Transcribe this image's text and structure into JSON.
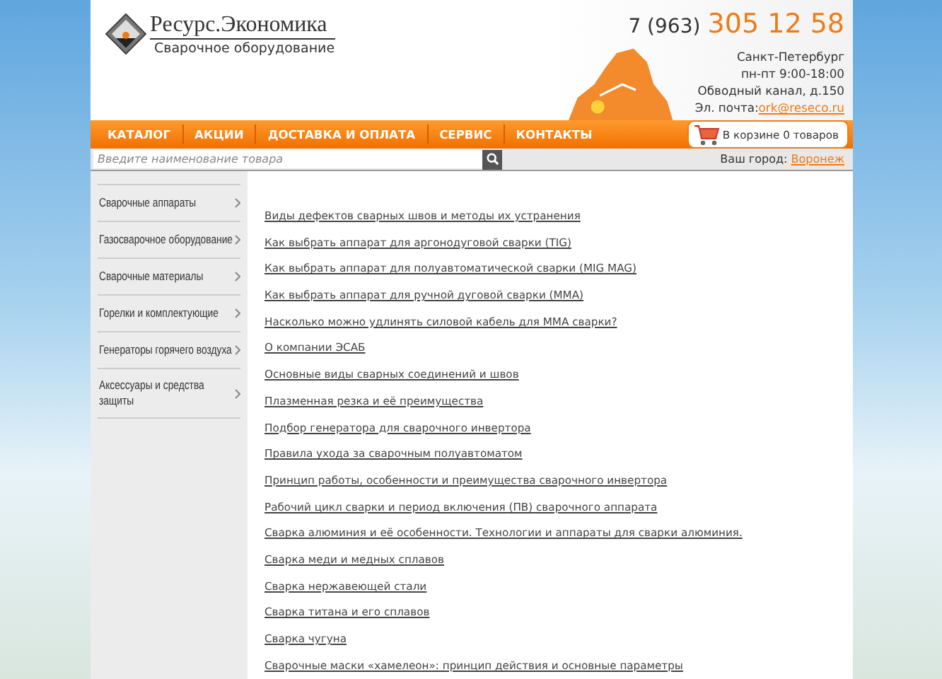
{
  "header": {
    "logo_title": "Ресурс.Экономика",
    "logo_subtitle": "Сварочное оборудование",
    "phone_prefix": "7 (963)",
    "phone_number": "305 12 58",
    "address_lines": [
      "Санкт-Петербург",
      "пн-пт 9:00-18:00",
      "Обводный канал, д.150"
    ],
    "email_label": "Эл. почта:",
    "email": "ork@reseco.ru"
  },
  "nav": {
    "items": [
      {
        "label": "КАТАЛОГ"
      },
      {
        "label": "АКЦИИ"
      },
      {
        "label": "ДОСТАВКА И ОПЛАТА"
      },
      {
        "label": "СЕРВИС"
      },
      {
        "label": "КОНТАКТЫ"
      }
    ],
    "cart": "В корзине 0 товаров"
  },
  "search": {
    "placeholder": "Введите наименование товара",
    "city_label": "Ваш город:",
    "city": "Воронеж"
  },
  "sidebar": {
    "items": [
      "Сварочные аппараты",
      "Газосварочное оборудование",
      "Сварочные материалы",
      "Горелки и комплектующие",
      "Генераторы горячего воздуха",
      "Аксессуары и средства защиты"
    ]
  },
  "articles": [
    "Виды дефектов сварных швов и методы их устранения",
    "Как выбрать аппарат для аргонодуговой сварки (TIG)",
    "Как выбрать аппарат для полуавтоматической сварки (MIG MAG)",
    "Как выбрать аппарат для ручной дуговой сварки (MMA)",
    "Насколько можно удлинять силовой кабель для MMA сварки?",
    "О компании ЭСАБ",
    "Основные виды сварных соединений и швов",
    "Плазменная резка и её преимущества",
    "Подбор генератора для сварочного инвертора",
    "Правила ухода за сварочным полуавтоматом",
    "Принцип работы, особенности и преимущества сварочного инвертора",
    "Рабочий цикл сварки и период включения (ПВ) сварочного аппарата",
    "Сварка алюминия и её особенности. Технологии и аппараты для сварки алюминия.",
    "Сварка меди и медных сплавов",
    "Сварка нержавеющей стали",
    "Сварка титана и его сплавов",
    "Сварка чугуна",
    "Сварочные маски «хамелеон»: принцип действия и основные параметры"
  ]
}
